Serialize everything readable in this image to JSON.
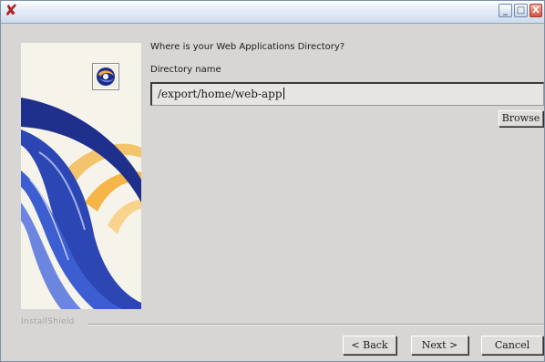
{
  "window": {
    "app_icon": "x-logo-icon",
    "minimize": "_",
    "maximize": "□",
    "close": "X"
  },
  "wizard": {
    "question": "Where is your Web Applications Directory?",
    "directory_label": "Directory name",
    "directory_value": "/export/home/web-app",
    "browse_label": "Browse",
    "brand": "InstallShield"
  },
  "buttons": {
    "back": "< Back",
    "next": "Next >",
    "cancel": "Cancel"
  },
  "colors": {
    "accent_blue": "#1e2f8c",
    "accent_orange": "#f3a93a",
    "panel_bg": "#d7d6d4",
    "title_bar": "#dfe8f4"
  }
}
